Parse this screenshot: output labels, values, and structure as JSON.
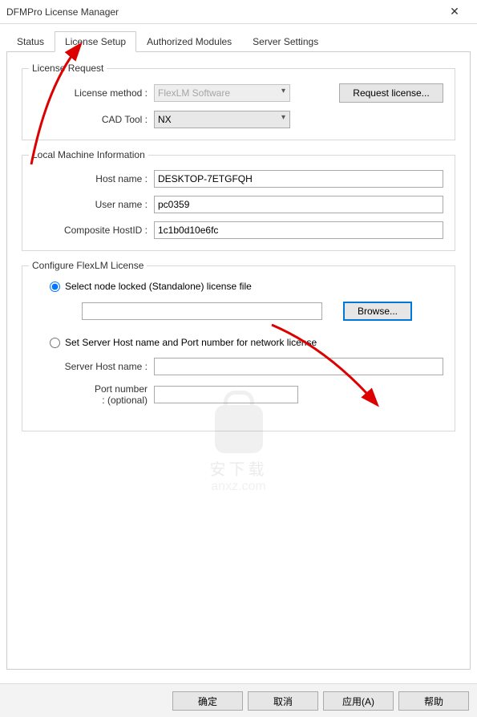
{
  "window": {
    "title": "DFMPro License Manager"
  },
  "tabs": {
    "status": "Status",
    "license_setup": "License Setup",
    "authorized_modules": "Authorized Modules",
    "server_settings": "Server Settings"
  },
  "license_request": {
    "title": "License Request",
    "method_label": "License method :",
    "method_value": "FlexLM Software",
    "cad_label": "CAD Tool :",
    "cad_value": "NX",
    "request_btn": "Request license..."
  },
  "local_machine": {
    "title": "Local Machine Information",
    "host_label": "Host name :",
    "host_value": "DESKTOP-7ETGFQH",
    "user_label": "User name :",
    "user_value": "pc0359",
    "composite_label": "Composite HostID :",
    "composite_value": "1c1b0d10e6fc"
  },
  "configure": {
    "title": "Configure FlexLM License",
    "radio_node": "Select node locked (Standalone) license file",
    "browse_btn": "Browse...",
    "radio_server": "Set Server Host name and Port number for network license",
    "server_host_label": "Server Host name :",
    "server_host_value": "",
    "port_label_1": "Port number",
    "port_label_2": ": (optional)",
    "port_value": "",
    "file_value": ""
  },
  "buttons": {
    "ok": "确定",
    "cancel": "取消",
    "apply": "应用(A)",
    "help": "帮助"
  },
  "watermark": {
    "line1": "安下载",
    "line2": "anxz.com"
  }
}
